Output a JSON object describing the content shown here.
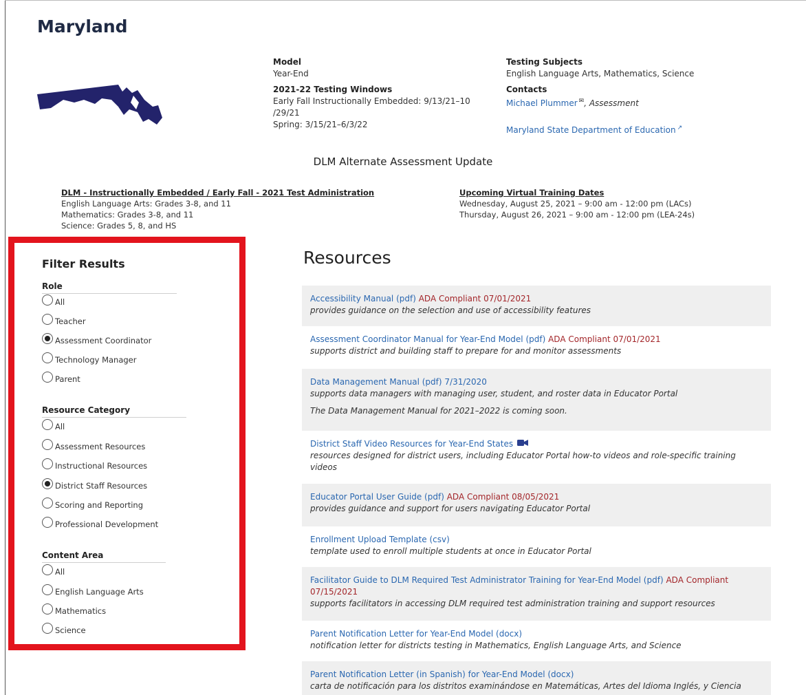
{
  "page_title": "Maryland",
  "state_info": {
    "model_label": "Model",
    "model_value": "Year-End",
    "windows_label": "2021-22 Testing Windows",
    "windows_line1": "Early Fall Instructionally Embedded: 9/13/21–10",
    "windows_line2": "/29/21",
    "windows_line3": "Spring: 3/15/21–6/3/22",
    "subjects_label": "Testing Subjects",
    "subjects_value": "English Language Arts, Mathematics, Science",
    "contacts_label": "Contacts",
    "contact_name": "Michael Plummer",
    "contact_role": ", Assessment",
    "state_dept_link": "Maryland State Department of Education"
  },
  "update_heading": "DLM Alternate Assessment Update",
  "news_left": {
    "title": "DLM - Instructionally Embedded / Early Fall - 2021 Test Administration",
    "lines": [
      "English Language Arts: Grades 3-8, and 11",
      "Mathematics: Grades 3-8, and 11",
      "Science: Grades 5, 8, and HS"
    ]
  },
  "news_right": {
    "title": "Upcoming Virtual Training Dates",
    "lines": [
      "Wednesday, August 25, 2021 – 9:00 am - 12:00 pm (LACs)",
      "Thursday, August 26, 2021 – 9:00 am - 12:00 pm (LEA-24s)"
    ]
  },
  "filter": {
    "title": "Filter Results",
    "role": {
      "label": "Role",
      "options": [
        {
          "label": "All",
          "checked": false
        },
        {
          "label": "Teacher",
          "checked": false
        },
        {
          "label": "Assessment Coordinator",
          "checked": true
        },
        {
          "label": "Technology Manager",
          "checked": false
        },
        {
          "label": "Parent",
          "checked": false
        }
      ]
    },
    "category": {
      "label": "Resource Category",
      "options": [
        {
          "label": "All",
          "checked": false
        },
        {
          "label": "Assessment Resources",
          "checked": false
        },
        {
          "label": "Instructional Resources",
          "checked": false
        },
        {
          "label": "District Staff Resources",
          "checked": true
        },
        {
          "label": "Scoring and Reporting",
          "checked": false
        },
        {
          "label": "Professional Development",
          "checked": false
        }
      ]
    },
    "content": {
      "label": "Content Area",
      "options": [
        {
          "label": "All",
          "checked": false
        },
        {
          "label": "English Language Arts",
          "checked": false
        },
        {
          "label": "Mathematics",
          "checked": false
        },
        {
          "label": "Science",
          "checked": false
        }
      ]
    }
  },
  "resources_title": "Resources",
  "resources": [
    {
      "link": "Accessibility Manual (pdf)",
      "ada": " ADA Compliant 07/01/2021",
      "extra": "",
      "desc": "provides guidance on the selection and use of accessibility features",
      "note": "",
      "video": false
    },
    {
      "link": "Assessment Coordinator Manual for Year-End Model (pdf)",
      "ada": " ADA Compliant 07/01/2021",
      "extra": "",
      "desc": "supports district and building staff to prepare for and monitor assessments",
      "note": "",
      "video": false
    },
    {
      "link": "Data Management Manual (pdf)",
      "ada": "",
      "extra": " 7/31/2020",
      "desc": "supports data managers with managing user, student, and roster data in Educator Portal",
      "note": "The Data Management Manual for 2021–2022 is coming soon.",
      "video": false
    },
    {
      "link": "District Staff Video Resources for Year-End States",
      "ada": "",
      "extra": "",
      "desc": "resources designed for district users, including Educator Portal how-to videos and role-specific training videos",
      "note": "",
      "video": true
    },
    {
      "link": "Educator Portal User Guide (pdf)",
      "ada": " ADA Compliant 08/05/2021",
      "extra": "",
      "desc": "provides guidance and support for users navigating Educator Portal",
      "note": "",
      "video": false
    },
    {
      "link": "Enrollment Upload Template (csv)",
      "ada": "",
      "extra": "",
      "desc": "template used to enroll multiple students at once in Educator Portal",
      "note": "",
      "video": false
    },
    {
      "link": "Facilitator Guide to DLM Required Test Administrator Training for Year-End Model (pdf)",
      "ada": " ADA Compliant 07/15/2021",
      "extra": "",
      "desc": "supports facilitators in accessing DLM required test administration training and support resources",
      "note": "",
      "video": false
    },
    {
      "link": "Parent Notification Letter for Year-End Model (docx)",
      "ada": "",
      "extra": "",
      "desc": "notification letter for districts testing in Mathematics, English Language Arts, and Science",
      "note": "",
      "video": false
    },
    {
      "link": "Parent Notification Letter (in Spanish) for Year-End Model (docx)",
      "ada": "",
      "extra": "",
      "desc": "carta de notificación para los distritos examinándose en Matemáticas, Artes del Idioma Inglés, y Ciencia",
      "note": "",
      "video": false
    }
  ]
}
